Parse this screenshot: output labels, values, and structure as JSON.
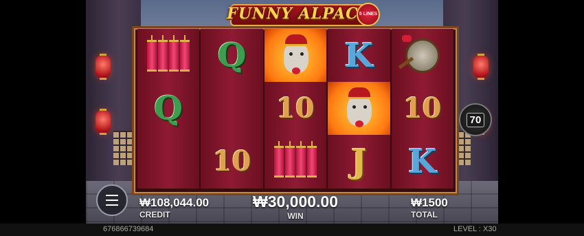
{
  "game": {
    "title": "FUNNY ALPACA",
    "lines_badge": "5 LINES"
  },
  "reels": [
    [
      "firecracker",
      "Q",
      ""
    ],
    [
      "Q",
      "",
      "10"
    ],
    [
      "alpaca",
      "10",
      "firecracker"
    ],
    [
      "K",
      "alpaca",
      "J"
    ],
    [
      "gong",
      "10",
      "K"
    ]
  ],
  "bet_badge": "70",
  "credit": {
    "value": "₩108,044.00",
    "label": "CREDIT"
  },
  "win": {
    "value": "₩30,000.00",
    "label": "WIN"
  },
  "total": {
    "value": "₩1500",
    "label": "TOTAL"
  },
  "session_id": "676866739684",
  "level": {
    "label": "LEVEL :",
    "value": "X30"
  }
}
